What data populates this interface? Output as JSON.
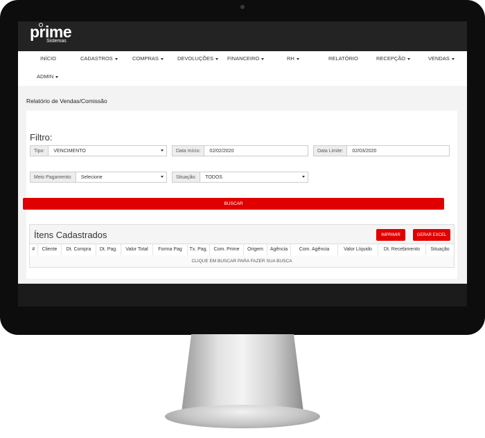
{
  "brand": {
    "name": "prime",
    "subtitle": "Sistemas"
  },
  "nav": {
    "items": [
      {
        "label": "INÍCIO",
        "dropdown": false
      },
      {
        "label": "CADASTROS",
        "dropdown": true
      },
      {
        "label": "COMPRAS",
        "dropdown": true
      },
      {
        "label": "DEVOLUÇÕES",
        "dropdown": true
      },
      {
        "label": "FINANCEIRO",
        "dropdown": true
      },
      {
        "label": "RH",
        "dropdown": true
      },
      {
        "label": "RELATÓRIO",
        "dropdown": false
      },
      {
        "label": "RECEPÇÃO",
        "dropdown": true
      },
      {
        "label": "VENDAS",
        "dropdown": true
      },
      {
        "label": "ADMIN",
        "dropdown": true
      }
    ]
  },
  "page": {
    "title": "Relatório de Vendas/Comissão"
  },
  "filter": {
    "heading": "Filtro:",
    "tipo": {
      "label": "Tipo:",
      "value": "VENCIMENTO"
    },
    "data_inicio": {
      "label": "Data Início:",
      "value": "02/02/2020"
    },
    "data_limite": {
      "label": "Data Limite:",
      "value": "02/03/2020"
    },
    "meio_pagamento": {
      "label": "Meio Pagamento:",
      "value": "Selecione"
    },
    "situacao": {
      "label": "Situação:",
      "value": "TODOS"
    },
    "search_label": "BUSCAR"
  },
  "results": {
    "title": "Ítens Cadastrados",
    "print_label": "IMPRIMIR",
    "excel_label": "GERAR EXCEL",
    "columns": [
      "#",
      "Cliente",
      "Dt. Compra",
      "Dt. Pag.",
      "Valor Total",
      "Forma Pag",
      "Tx. Pag.",
      "Com. Prime",
      "Origem",
      "Agência",
      "Com. Agência",
      "Valor Líquido",
      "Dt. Recebimento",
      "Situação"
    ],
    "empty_message": "CLIQUE EM BUSCAR PARA FAZER SUA BUSCA"
  },
  "colors": {
    "accent": "#e10000",
    "topbar": "#232323",
    "bezel": "#0d0d0d"
  }
}
